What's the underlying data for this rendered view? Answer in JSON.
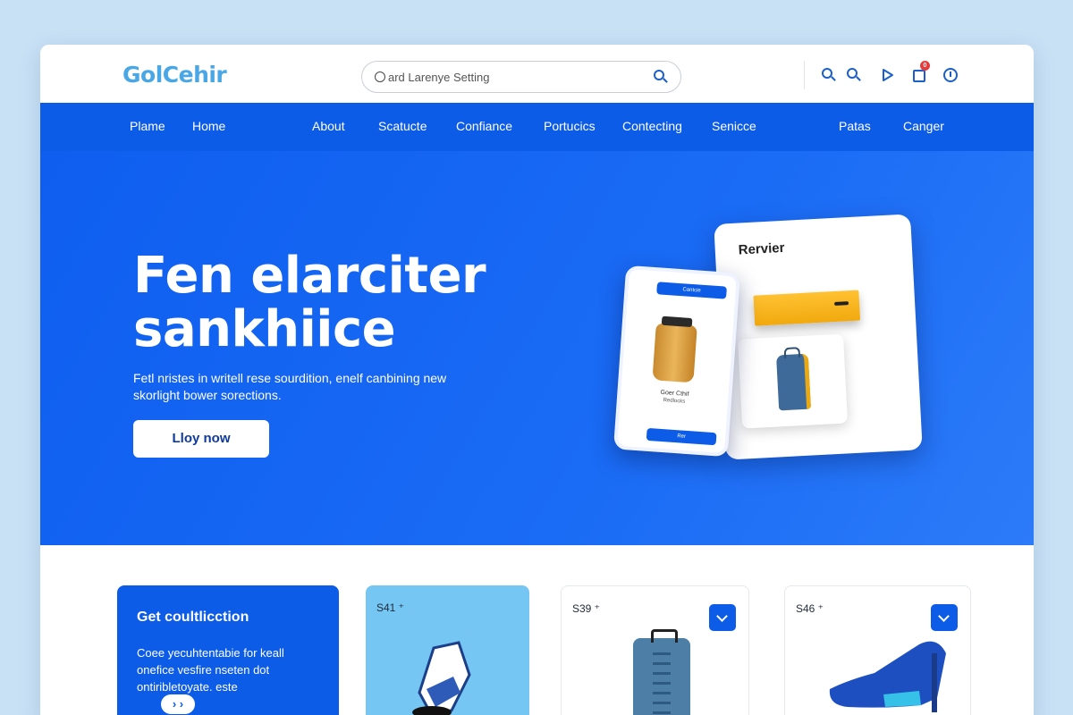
{
  "header": {
    "logo": "GolCehir",
    "search_placeholder": "ard Larenye Setting",
    "icons": [
      "search-icon",
      "search-icon",
      "play-icon",
      "cart-icon",
      "clock-icon"
    ],
    "cart_badge": "0"
  },
  "nav": {
    "items": [
      "Plame",
      "Home",
      "About",
      "Scatucte",
      "Confiance",
      "Portucics",
      "Contecting",
      "Senicce",
      "Patas",
      "Canger"
    ]
  },
  "hero": {
    "title_line1": "Fen elarciter",
    "title_line2": "sankhiice",
    "subtitle": "Fetl nristes in writell rese sourdition, enelf canbining new skorlight bower sorections.",
    "cta": "Lloy now",
    "card_title": "Rervier",
    "phone_top_label": "Cantcie",
    "phone_item_label": "Goer Cthif",
    "phone_item_sub": "Redlocks",
    "phone_button": "Rer"
  },
  "products": {
    "promo_title": "Get coultlicction",
    "promo_text": "Coee yecuhtentabie for keall onefice vesfire nseten dot ontiribletoyate. este",
    "promo_arrows": "› ›",
    "cards": [
      {
        "price": "S41 ⁺"
      },
      {
        "price": "S39 ⁺"
      },
      {
        "price": "S46 ⁺"
      }
    ]
  },
  "colors": {
    "primary": "#0c5ce8",
    "logo": "#4aa7e6",
    "card_light_blue": "#75c6f3",
    "badge": "#e63b3b"
  }
}
